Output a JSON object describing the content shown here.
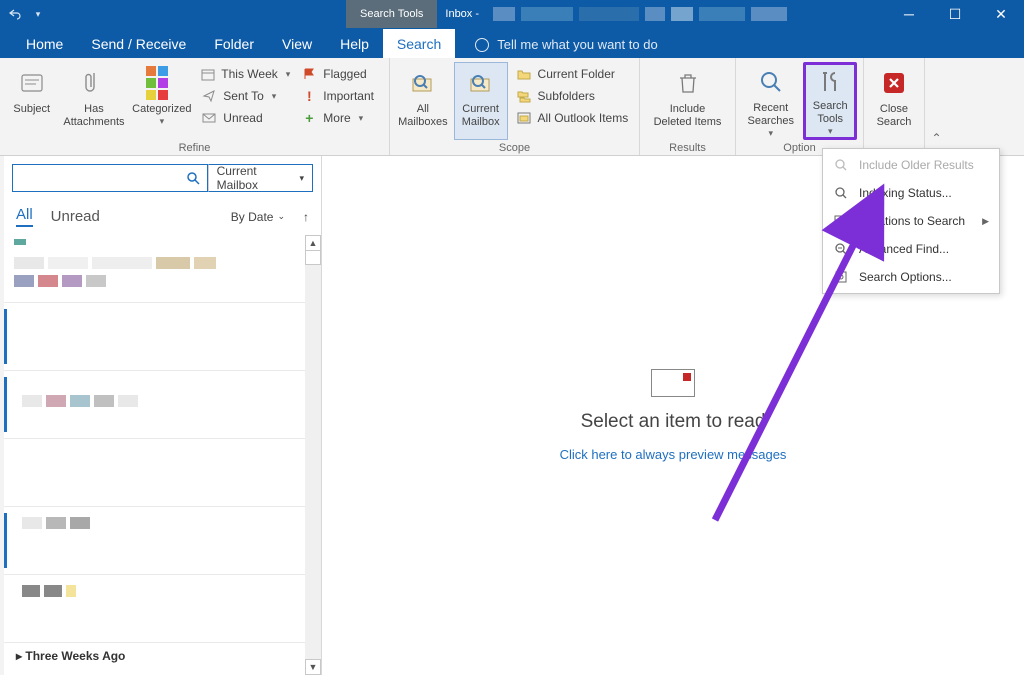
{
  "titlebar": {
    "context_tab": "Search Tools",
    "title": "Inbox -"
  },
  "tabs": {
    "home": "Home",
    "send_receive": "Send / Receive",
    "folder": "Folder",
    "view": "View",
    "help": "Help",
    "search": "Search",
    "tell_me": "Tell me what you want to do"
  },
  "ribbon": {
    "refine": {
      "subject": "Subject",
      "has_attachments": "Has\nAttachments",
      "categorized": "Categorized",
      "this_week": "This Week",
      "sent_to": "Sent To",
      "unread": "Unread",
      "flagged": "Flagged",
      "important": "Important",
      "more": "More",
      "label": "Refine"
    },
    "scope": {
      "all_mailboxes": "All\nMailboxes",
      "current_mailbox": "Current\nMailbox",
      "current_folder": "Current Folder",
      "subfolders": "Subfolders",
      "all_outlook_items": "All Outlook Items",
      "label": "Scope"
    },
    "results": {
      "include_deleted": "Include\nDeleted Items",
      "label": "Results"
    },
    "options": {
      "recent_searches": "Recent\nSearches",
      "search_tools": "Search\nTools",
      "label": "Option"
    },
    "close": {
      "close_search": "Close\nSearch"
    }
  },
  "search": {
    "placeholder": "",
    "scope_label": "Current Mailbox"
  },
  "list": {
    "filter_all": "All",
    "filter_unread": "Unread",
    "sort_by": "By Date",
    "group_header": "Three Weeks Ago"
  },
  "preview": {
    "title": "Select an item to read",
    "link": "Click here to always preview messages"
  },
  "dropdown": {
    "include_older": "Include Older Results",
    "indexing_status": "Indexing Status...",
    "locations": "Locations to Search",
    "advanced_find": "Advanced Find...",
    "search_options": "Search Options..."
  }
}
